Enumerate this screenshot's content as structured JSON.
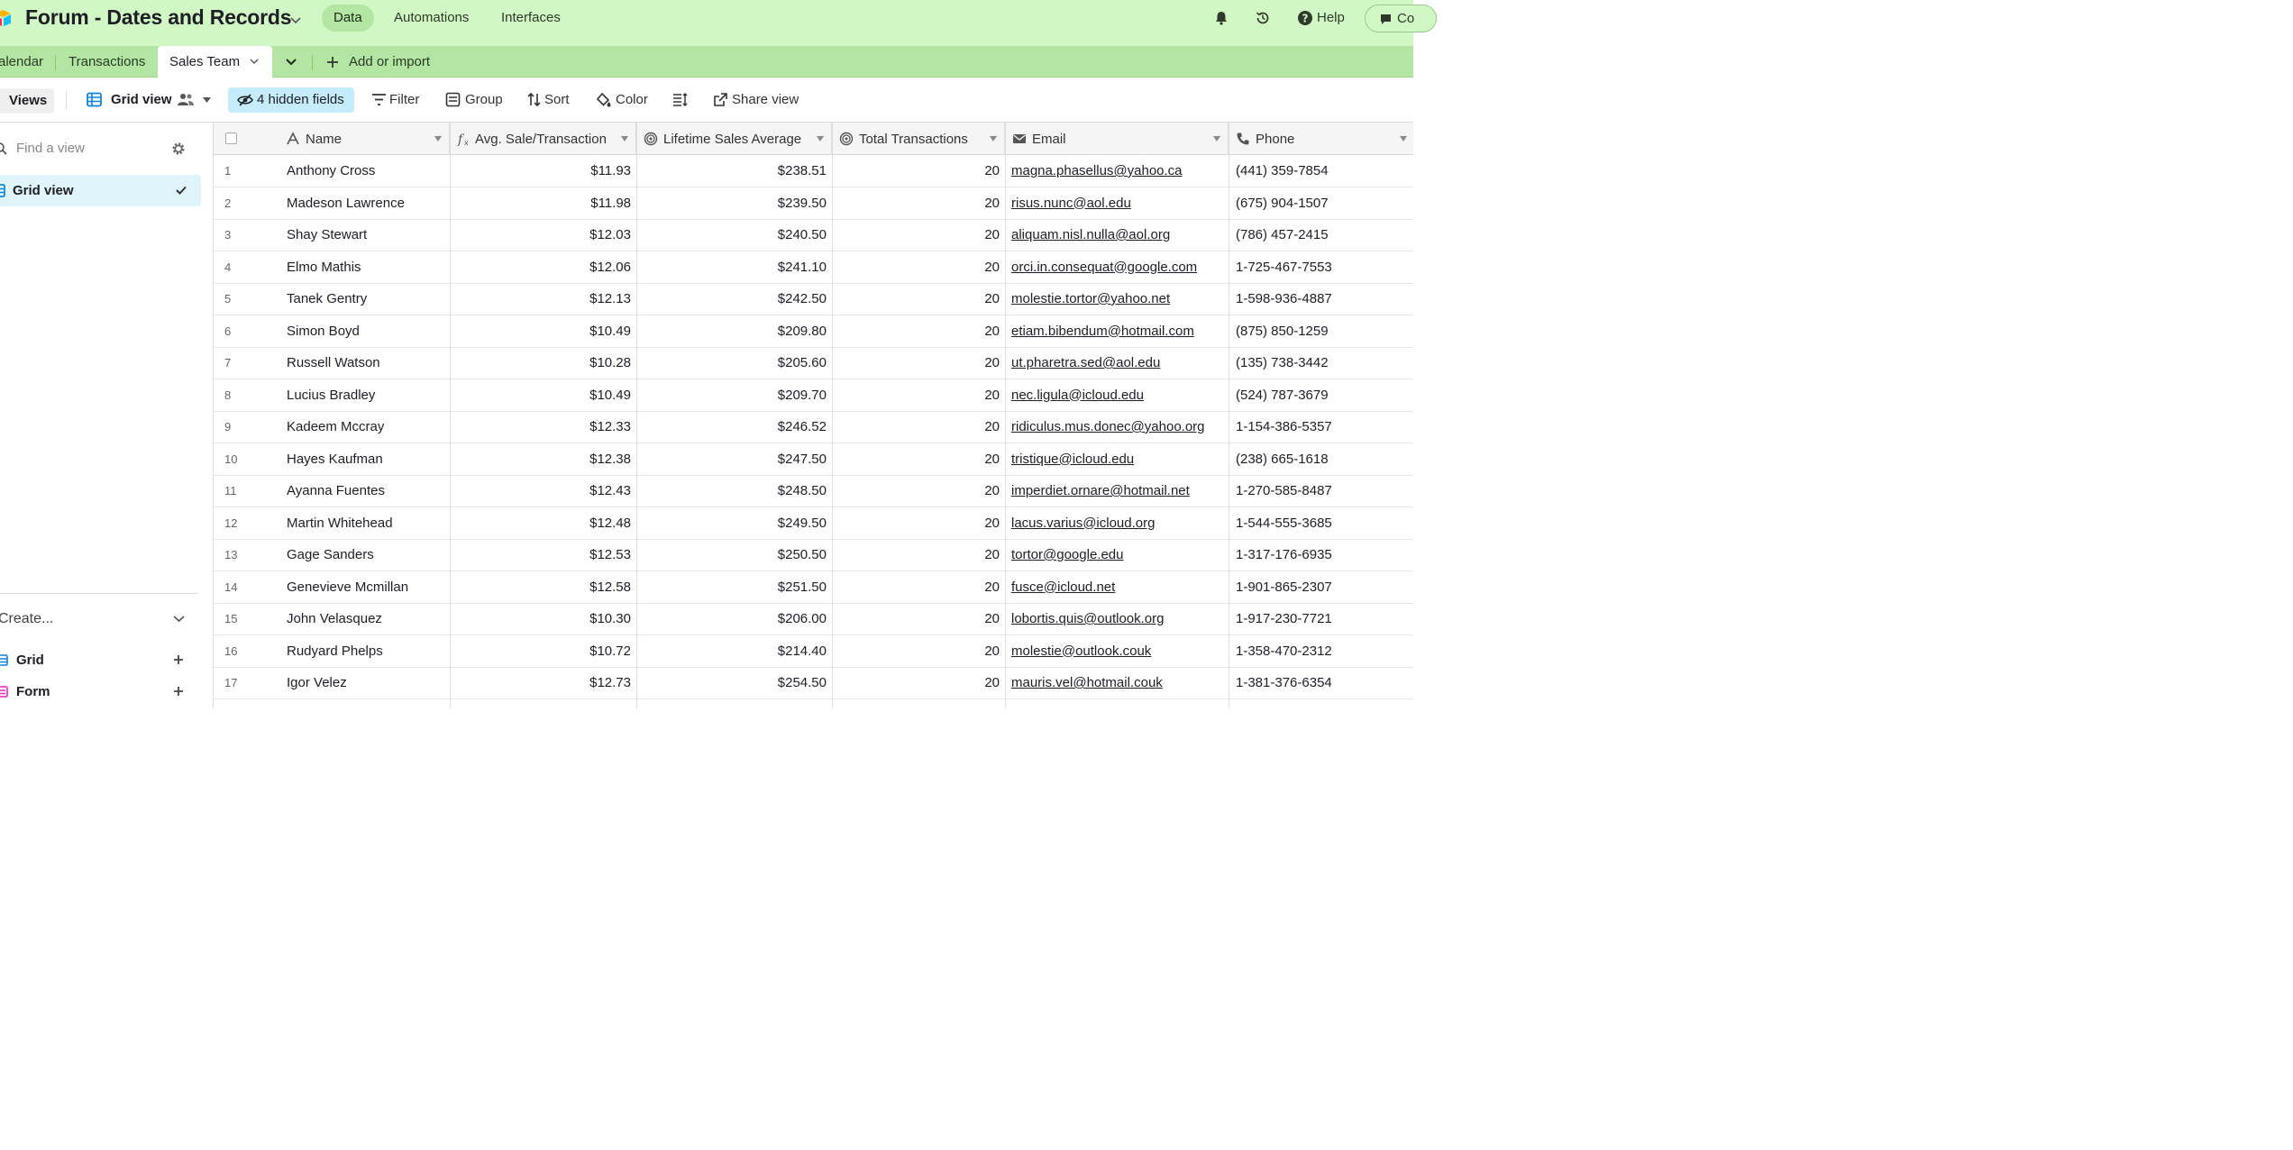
{
  "header": {
    "base_title": "Forum - Dates and Records",
    "nav": [
      "Data",
      "Automations",
      "Interfaces"
    ],
    "help": "Help",
    "comment_partial": "Co"
  },
  "tabs": {
    "items": [
      "alendar",
      "Transactions"
    ],
    "active": "Sales Team",
    "add": "Add or import"
  },
  "toolbar": {
    "views": "Views",
    "view_name": "Grid view",
    "hidden_fields": "4 hidden fields",
    "filter": "Filter",
    "group": "Group",
    "sort": "Sort",
    "color": "Color",
    "share": "Share view"
  },
  "sidebar": {
    "find_placeholder": "Find a view",
    "selected_view": "Grid view",
    "create_label": "Create...",
    "create_items": [
      "Grid",
      "Form"
    ]
  },
  "colors": {
    "header_bg": "#d1f7c4",
    "tab_bg": "#b3e6a2",
    "accent_blue": "#1283da",
    "hidden_fields_bg": "#c4ecfb",
    "form_pink": "#e929ba"
  },
  "table": {
    "columns": [
      "Name",
      "Avg. Sale/Transaction",
      "Lifetime Sales Average",
      "Total Transactions",
      "Email",
      "Phone"
    ],
    "rows": [
      [
        "1",
        "Anthony Cross",
        "$11.93",
        "$238.51",
        "20",
        "magna.phasellus@yahoo.ca",
        "(441) 359-7854"
      ],
      [
        "2",
        "Madeson Lawrence",
        "$11.98",
        "$239.50",
        "20",
        "risus.nunc@aol.edu",
        "(675) 904-1507"
      ],
      [
        "3",
        "Shay Stewart",
        "$12.03",
        "$240.50",
        "20",
        "aliquam.nisl.nulla@aol.org",
        "(786) 457-2415"
      ],
      [
        "4",
        "Elmo Mathis",
        "$12.06",
        "$241.10",
        "20",
        "orci.in.consequat@google.com",
        "1-725-467-7553"
      ],
      [
        "5",
        "Tanek Gentry",
        "$12.13",
        "$242.50",
        "20",
        "molestie.tortor@yahoo.net",
        "1-598-936-4887"
      ],
      [
        "6",
        "Simon Boyd",
        "$10.49",
        "$209.80",
        "20",
        "etiam.bibendum@hotmail.com",
        "(875) 850-1259"
      ],
      [
        "7",
        "Russell Watson",
        "$10.28",
        "$205.60",
        "20",
        "ut.pharetra.sed@aol.edu",
        "(135) 738-3442"
      ],
      [
        "8",
        "Lucius Bradley",
        "$10.49",
        "$209.70",
        "20",
        "nec.ligula@icloud.edu",
        "(524) 787-3679"
      ],
      [
        "9",
        "Kadeem Mccray",
        "$12.33",
        "$246.52",
        "20",
        "ridiculus.mus.donec@yahoo.org",
        "1-154-386-5357"
      ],
      [
        "10",
        "Hayes Kaufman",
        "$12.38",
        "$247.50",
        "20",
        "tristique@icloud.edu",
        "(238) 665-1618"
      ],
      [
        "11",
        "Ayanna Fuentes",
        "$12.43",
        "$248.50",
        "20",
        "imperdiet.ornare@hotmail.net",
        "1-270-585-8487"
      ],
      [
        "12",
        "Martin Whitehead",
        "$12.48",
        "$249.50",
        "20",
        "lacus.varius@icloud.org",
        "1-544-555-3685"
      ],
      [
        "13",
        "Gage Sanders",
        "$12.53",
        "$250.50",
        "20",
        "tortor@google.edu",
        "1-317-176-6935"
      ],
      [
        "14",
        "Genevieve Mcmillan",
        "$12.58",
        "$251.50",
        "20",
        "fusce@icloud.net",
        "1-901-865-2307"
      ],
      [
        "15",
        "John Velasquez",
        "$10.30",
        "$206.00",
        "20",
        "lobortis.quis@outlook.org",
        "1-917-230-7721"
      ],
      [
        "16",
        "Rudyard Phelps",
        "$10.72",
        "$214.40",
        "20",
        "molestie@outlook.couk",
        "1-358-470-2312"
      ],
      [
        "17",
        "Igor Velez",
        "$12.73",
        "$254.50",
        "20",
        "mauris.vel@hotmail.couk",
        "1-381-376-6354"
      ]
    ]
  }
}
